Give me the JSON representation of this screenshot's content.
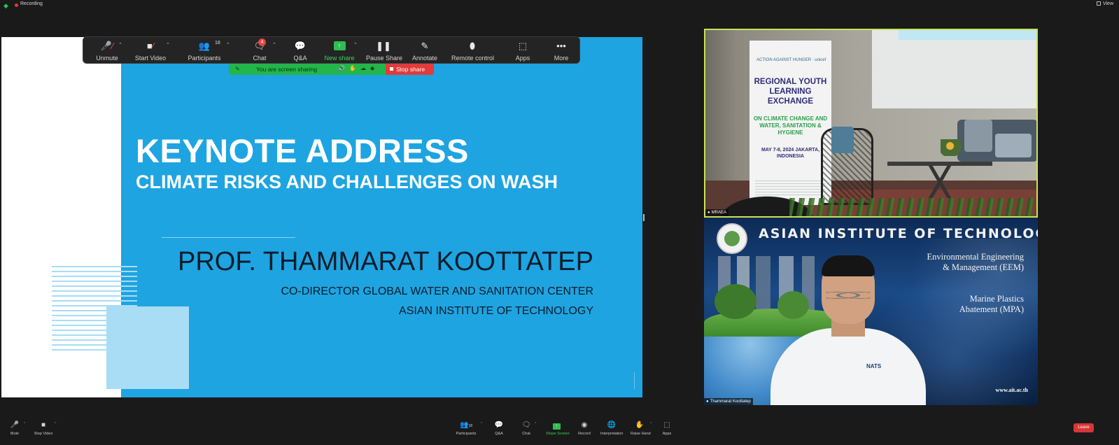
{
  "topbar": {
    "recording_label": "Recording",
    "view_label": "View"
  },
  "toolbar": {
    "unmute": "Unmute",
    "start_video": "Start Video",
    "participants": "Participants",
    "participants_count": "18",
    "chat": "Chat",
    "chat_badge": "4",
    "qa": "Q&A",
    "new_share": "New share",
    "pause_share": "Pause Share",
    "annotate": "Annotate",
    "remote_control": "Remote control",
    "apps": "Apps",
    "more": "More"
  },
  "sharebar": {
    "status_text": "You are screen sharing",
    "stop_share": "Stop share"
  },
  "slide": {
    "title": "KEYNOTE ADDRESS",
    "subtitle": "CLIMATE RISKS AND CHALLENGES ON WASH",
    "speaker": "PROF. THAMMARAT KOOTTATEP",
    "role_line1": "CO-DIRECTOR GLOBAL WATER AND SANITATION CENTER",
    "role_line2": "ASIAN INSTITUTE OF TECHNOLOGY",
    "colors": {
      "background": "#1ea4e1",
      "accent_light": "#a9ddf6"
    }
  },
  "video_tiles": [
    {
      "name": "MRAEA",
      "banner": {
        "logos": "ACTION AGAINST HUNGER  ·  unicef",
        "headline": "REGIONAL YOUTH LEARNING EXCHANGE",
        "subhead": "ON CLIMATE CHANGE AND WATER, SANITATION & HYGIENE",
        "date_place": "MAY 7-8, 2024 JAKARTA, INDONESIA"
      },
      "active_speaker_color": "#c9e357"
    },
    {
      "name": "Thammarat Koottatep",
      "background": {
        "institute": "ASIAN INSTITUTE OF TECHNOLOGY",
        "program1_line1": "Environmental Engineering",
        "program1_line2": "& Management (EEM)",
        "program2_line1": "Marine Plastics",
        "program2_line2": "Abatement (MPA)",
        "url": "www.ait.ac.th",
        "shirt_logo": "NATS"
      }
    }
  ],
  "bottombar": {
    "mute": "Mute",
    "stop_video": "Stop Video",
    "participants": "Participants",
    "participants_count": "18",
    "qa": "Q&A",
    "chat": "Chat",
    "share_screen": "Share Screen",
    "record": "Record",
    "interpretation": "Interpretation",
    "raise_hand": "Raise Hand",
    "apps": "Apps",
    "leave": "Leave"
  }
}
